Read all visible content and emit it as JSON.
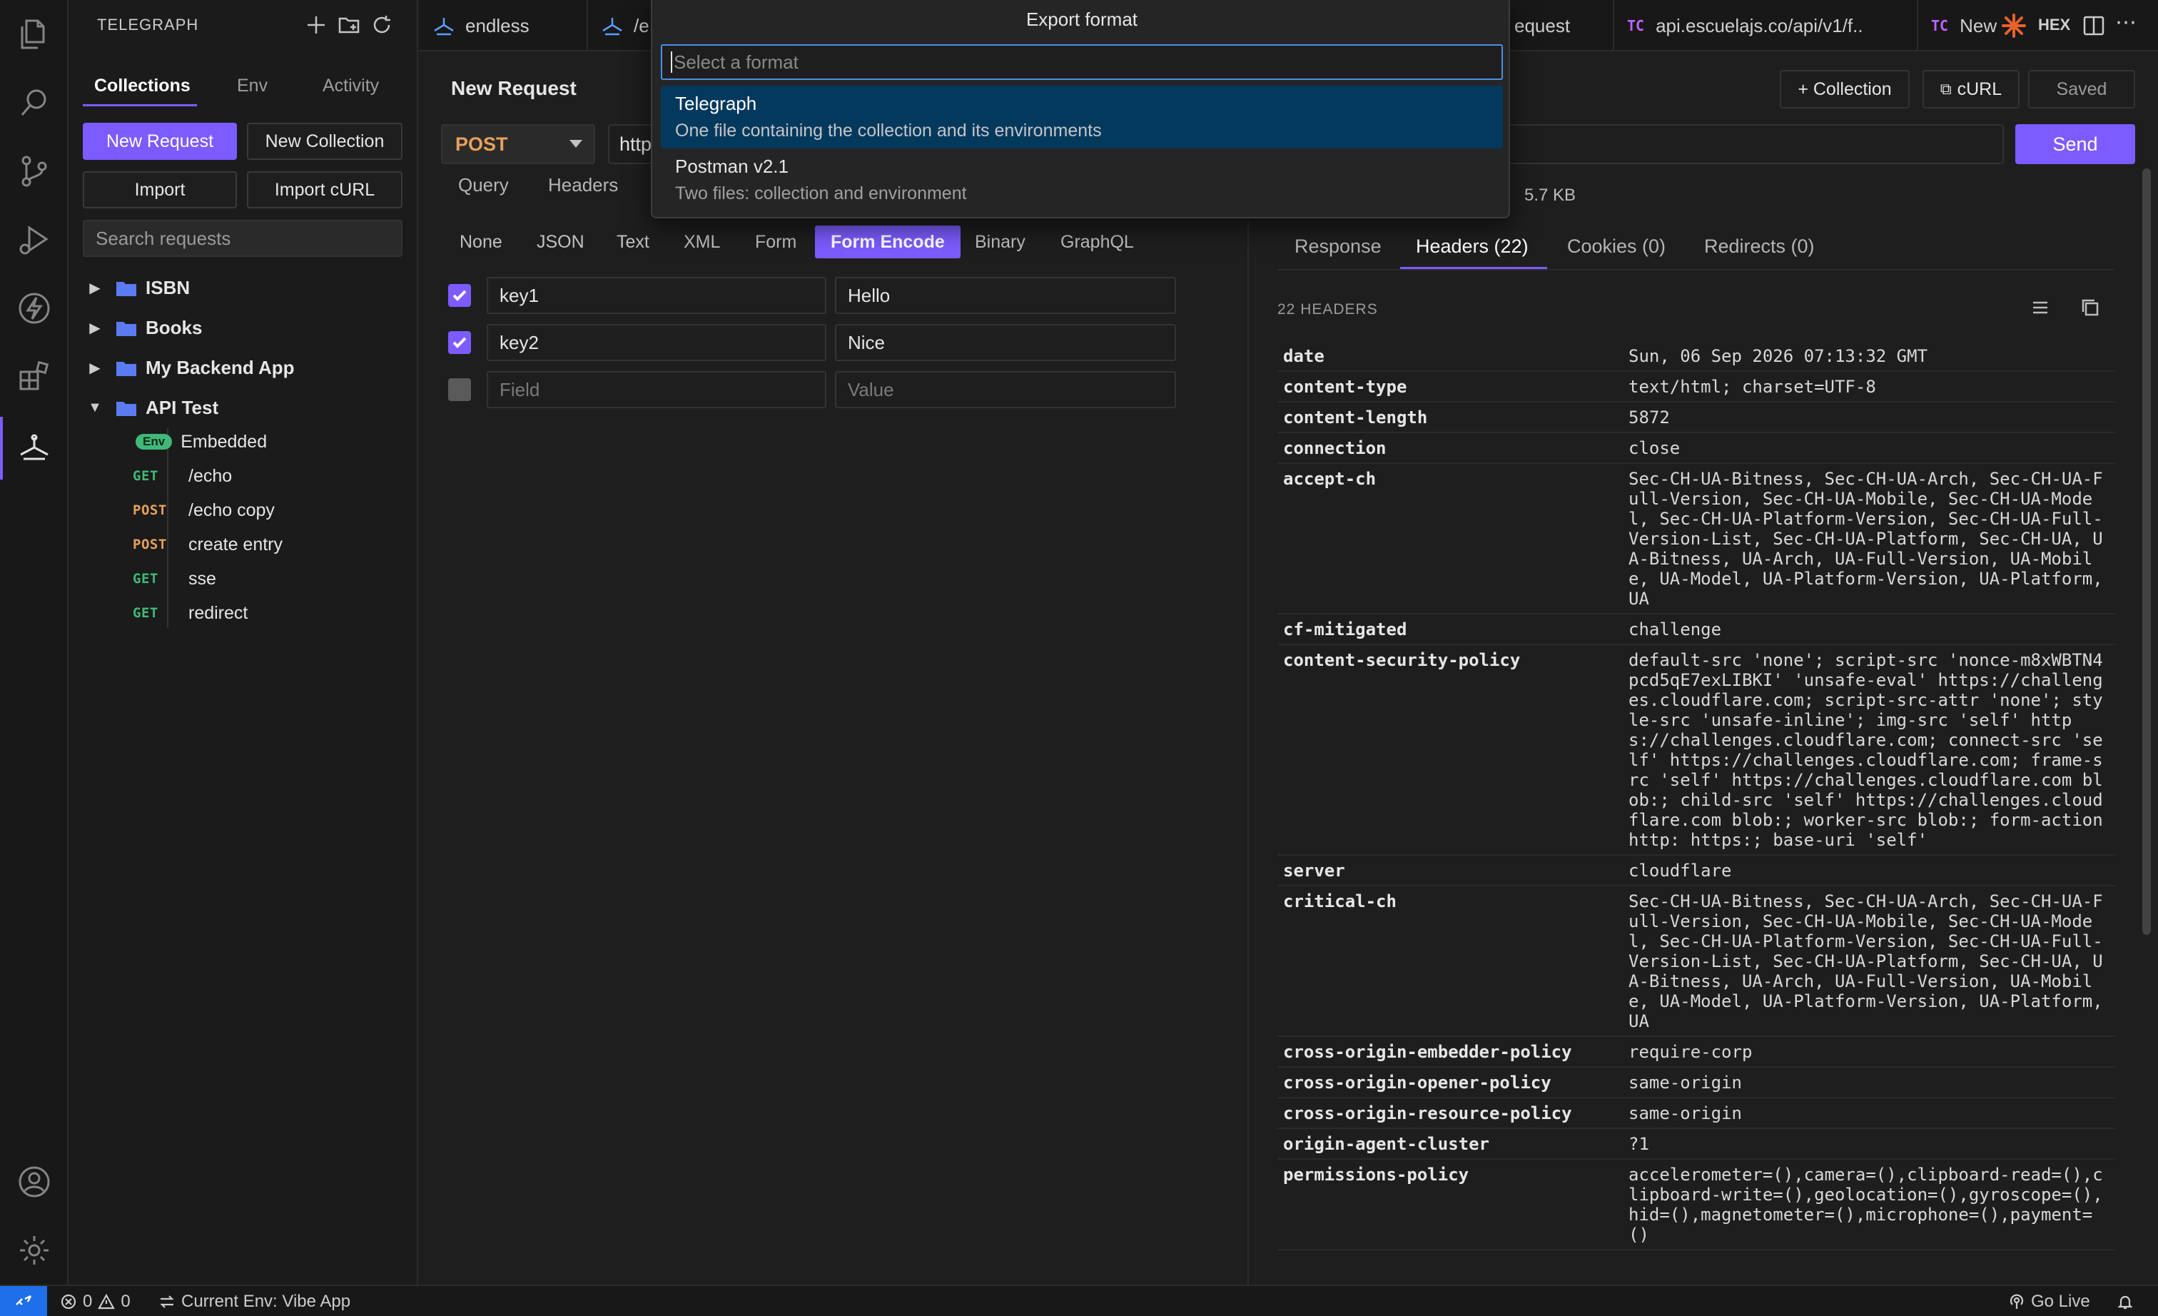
{
  "sidebar": {
    "title": "TELEGRAPH",
    "tabs": [
      "Collections",
      "Env",
      "Activity"
    ],
    "new_request": "New Request",
    "new_collection": "New Collection",
    "import": "Import",
    "import_curl": "Import cURL",
    "search_placeholder": "Search requests",
    "folders": [
      {
        "name": "ISBN",
        "expanded": false
      },
      {
        "name": "Books",
        "expanded": false
      },
      {
        "name": "My Backend App",
        "expanded": false
      },
      {
        "name": "API Test",
        "expanded": true
      }
    ],
    "env_badge": "Env",
    "env_label": "Embedded",
    "requests": [
      {
        "method": "GET",
        "path": "/echo"
      },
      {
        "method": "POST",
        "path": "/echo copy"
      },
      {
        "method": "POST",
        "path": "create entry"
      },
      {
        "method": "GET",
        "path": "sse"
      },
      {
        "method": "GET",
        "path": "redirect"
      }
    ]
  },
  "tabs": {
    "t1": "endless",
    "t2": "/e",
    "t3": "equest",
    "t4_prefix": "TC",
    "t4": "api.escuelajs.co/api/v1/f..",
    "t5_prefix": "TC",
    "t5": "New",
    "hex": "HEX"
  },
  "palette": {
    "title": "Export format",
    "placeholder": "Select a format",
    "items": [
      {
        "label": "Telegraph",
        "desc": "One file containing the collection and its environments"
      },
      {
        "label": "Postman v2.1",
        "desc": "Two files: collection and environment"
      }
    ]
  },
  "request": {
    "title": "New Request",
    "method": "POST",
    "url": "http",
    "tabs": [
      "Query",
      "Headers"
    ],
    "body_types": [
      "None",
      "JSON",
      "Text",
      "XML",
      "Form",
      "Form Encode",
      "Binary",
      "GraphQL"
    ],
    "active_body_type": "Form Encode",
    "fields": [
      {
        "key": "key1",
        "value": "Hello",
        "checked": true
      },
      {
        "key": "key2",
        "value": "Nice",
        "checked": true
      }
    ],
    "field_placeholder": "Field",
    "value_placeholder": "Value"
  },
  "toolbar": {
    "collection": "+ Collection",
    "curl": "cURL",
    "saved": "Saved",
    "send": "Send"
  },
  "response": {
    "size": "5.7 KB",
    "tabs": [
      "Response",
      "Headers (22)",
      "Cookies (0)",
      "Redirects (0)"
    ],
    "headers_count": "22 HEADERS",
    "headers": [
      {
        "name": "date",
        "value": "Sun, 06 Sep 2026 07:13:32 GMT"
      },
      {
        "name": "content-type",
        "value": "text/html; charset=UTF-8"
      },
      {
        "name": "content-length",
        "value": "5872"
      },
      {
        "name": "connection",
        "value": "close"
      },
      {
        "name": "accept-ch",
        "value": "Sec-CH-UA-Bitness, Sec-CH-UA-Arch, Sec-CH-UA-Full-Version, Sec-CH-UA-Mobile, Sec-CH-UA-Model, Sec-CH-UA-Platform-Version, Sec-CH-UA-Full-Version-List, Sec-CH-UA-Platform, Sec-CH-UA, UA-Bitness, UA-Arch, UA-Full-Version, UA-Mobile, UA-Model, UA-Platform-Version, UA-Platform, UA"
      },
      {
        "name": "cf-mitigated",
        "value": "challenge"
      },
      {
        "name": "content-security-policy",
        "value": "default-src 'none'; script-src 'nonce-m8xWBTN4pcd5qE7exLIBKI' 'unsafe-eval' https://challenges.cloudflare.com; script-src-attr 'none'; style-src 'unsafe-inline'; img-src 'self' https://challenges.cloudflare.com; connect-src 'self' https://challenges.cloudflare.com; frame-src 'self' https://challenges.cloudflare.com blob:; child-src 'self' https://challenges.cloudflare.com blob:; worker-src blob:; form-action http: https:; base-uri 'self'"
      },
      {
        "name": "server",
        "value": "cloudflare"
      },
      {
        "name": "critical-ch",
        "value": "Sec-CH-UA-Bitness, Sec-CH-UA-Arch, Sec-CH-UA-Full-Version, Sec-CH-UA-Mobile, Sec-CH-UA-Model, Sec-CH-UA-Platform-Version, Sec-CH-UA-Full-Version-List, Sec-CH-UA-Platform, Sec-CH-UA, UA-Bitness, UA-Arch, UA-Full-Version, UA-Mobile, UA-Model, UA-Platform-Version, UA-Platform, UA"
      },
      {
        "name": "cross-origin-embedder-policy",
        "value": "require-corp"
      },
      {
        "name": "cross-origin-opener-policy",
        "value": "same-origin"
      },
      {
        "name": "cross-origin-resource-policy",
        "value": "same-origin"
      },
      {
        "name": "origin-agent-cluster",
        "value": "?1"
      },
      {
        "name": "permissions-policy",
        "value": "accelerometer=(),camera=(),clipboard-read=(),clipboard-write=(),geolocation=(),gyroscope=(),hid=(),magnetometer=(),microphone=(),payment=()"
      }
    ]
  },
  "statusbar": {
    "errors": "0",
    "warnings": "0",
    "env": "Current Env: Vibe App",
    "go_live": "Go Live"
  },
  "colors": {
    "accent": "#7c5cff",
    "get": "#3fb979",
    "post": "#e8a15a",
    "palette_selected": "#04395e",
    "remote": "#1f6feb"
  }
}
